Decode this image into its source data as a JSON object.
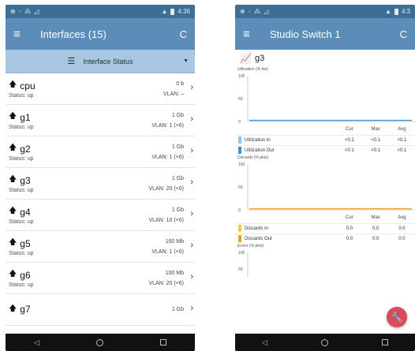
{
  "left": {
    "status_bar": {
      "left_icons": "⊕ ◦ ⁂ ◿",
      "right_text": "4:36"
    },
    "app_bar": {
      "title": "Interfaces (15)"
    },
    "filter": {
      "label": "Interface Status"
    },
    "interfaces": [
      {
        "name": "cpu",
        "status": "Status: up",
        "speed": "0 b",
        "vlan": "VLAN: –"
      },
      {
        "name": "g1",
        "status": "Status: up",
        "speed": "1 Gb",
        "vlan": "VLAN: 1 (+6)"
      },
      {
        "name": "g2",
        "status": "Status: up",
        "speed": "1 Gb",
        "vlan": "VLAN: 1 (+6)"
      },
      {
        "name": "g3",
        "status": "Status: up",
        "speed": "1 Gb",
        "vlan": "VLAN: 20 (+6)"
      },
      {
        "name": "g4",
        "status": "Status: up",
        "speed": "1 Gb",
        "vlan": "VLAN: 10 (+6)"
      },
      {
        "name": "g5",
        "status": "Status: up",
        "speed": "100 Mb",
        "vlan": "VLAN: 1 (+6)"
      },
      {
        "name": "g6",
        "status": "Status: up",
        "speed": "100 Mb",
        "vlan": "VLAN: 20 (+6)"
      },
      {
        "name": "g7",
        "status": "",
        "speed": "1 Gb",
        "vlan": ""
      }
    ]
  },
  "right": {
    "status_bar": {
      "left_icons": "⊕ ◦ ⁂ ◿",
      "right_text": "4:3"
    },
    "app_bar": {
      "title": "Studio Switch 1"
    },
    "interface_name": "g3",
    "charts": [
      {
        "label": "Utilization (% bw)",
        "yticks": [
          "100",
          "50",
          "0"
        ],
        "columns": [
          "Cur",
          "Max",
          "Avg"
        ],
        "rows": [
          {
            "name": "Utilization In",
            "color": "#90c4ec",
            "cur": "<0.1",
            "max": "<0.1",
            "avg": "<0.1"
          },
          {
            "name": "Utilization Out",
            "color": "#3a8fd6",
            "cur": "<0.1",
            "max": "<0.1",
            "avg": "<0.1"
          }
        ]
      },
      {
        "label": "Discards (% pkts)",
        "yticks": [
          "100",
          "50",
          "0"
        ],
        "columns": [
          "Cur",
          "Max",
          "Avg"
        ],
        "rows": [
          {
            "name": "Discards In",
            "color": "#f3c55a",
            "cur": "0.0",
            "max": "0.0",
            "avg": "0.0"
          },
          {
            "name": "Discards Out",
            "color": "#f0a01e",
            "cur": "0.0",
            "max": "0.0",
            "avg": "0.0"
          }
        ]
      },
      {
        "label": "Errors (% pkts)",
        "yticks": [
          "100",
          "50"
        ]
      }
    ]
  },
  "colors": {
    "app_bar": "#5b8db8",
    "status_bar": "#3d6f96",
    "filter_bar": "#a9c7e2",
    "fab": "#d94a5d"
  },
  "icons": {
    "menu": "menu-icon",
    "refresh": "refresh-icon",
    "filter": "filter-list-icon",
    "interface_up": "arrow-up-icon",
    "chart": "line-chart-icon",
    "fab": "wrench-icon"
  }
}
